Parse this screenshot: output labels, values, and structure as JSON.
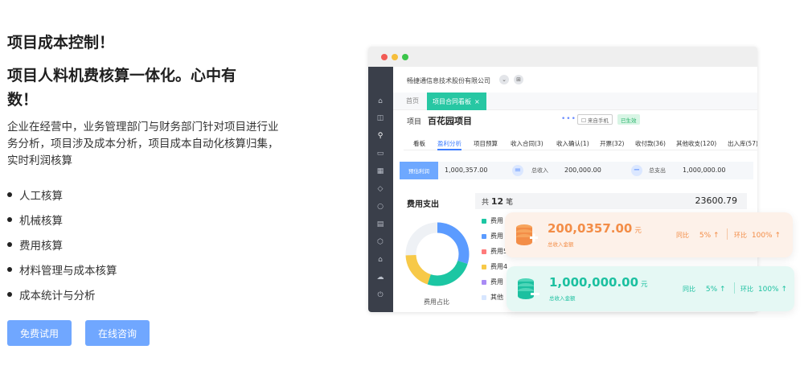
{
  "hero": {
    "title": "项目成本控制！",
    "subtitle": "项目人料机费核算一体化。心中有数！",
    "description": "企业在经营中，业务管理部门与财务部门针对项目进行业务分析，项目涉及成本分析，项目成本自动化核算归集，实时利润核算",
    "features": [
      "人工核算",
      "机械核算",
      "费用核算",
      "材料管理与成本核算",
      "成本统计与分析"
    ],
    "btn_try": "免费试用",
    "btn_consult": "在线咨询"
  },
  "app": {
    "company": "畅捷通信息技术股份有限公司",
    "tab_home": "首页",
    "tab_active": "项目合同看板",
    "tab_close": "×",
    "project_label": "项目",
    "project_name": "百花园项目",
    "project_more": "•••",
    "mobile_label": "☐ 来自手机",
    "status_badge": "已生效",
    "subnav": [
      "看板",
      "盈利分析",
      "项目预算",
      "收入合同(3)",
      "收入确认(1)",
      "开票(32)",
      "收付款(36)",
      "其他收支(120)",
      "出入库(57)"
    ],
    "calc": {
      "tag": "预估利润",
      "profit": "1,000,357.00",
      "op_eq": "=",
      "income_label": "总收入",
      "income": "200,000.00",
      "op_minus": "−",
      "expense_label": "总支出",
      "expense": "1,000,000.00"
    },
    "expense": {
      "title": "费用支出",
      "count_prefix": "共",
      "count": "12",
      "count_suffix": "笔",
      "total": "23600.79",
      "donut_label": "费用占比",
      "legend": [
        {
          "label": "费用",
          "color": "#1cc6a3"
        },
        {
          "label": "费用",
          "color": "#5b9bff"
        },
        {
          "label": "费用5",
          "color": "#ff7b7b"
        },
        {
          "label": "费用4",
          "color": "#f7c948"
        },
        {
          "label": "费用",
          "color": "#a98bf5"
        },
        {
          "label": "其他",
          "color": "#d7e6ff"
        }
      ]
    }
  },
  "cards": {
    "income": {
      "amount": "200,0357.00",
      "unit": "元",
      "label": "总收入金额",
      "yoy_label": "同比",
      "yoy": "5% ↑",
      "mom_label": "环比",
      "mom": "100% ↑"
    },
    "expense": {
      "amount": "1,000,000.00",
      "unit": "元",
      "label": "总收入金额",
      "yoy_label": "同比",
      "yoy": "5% ↑",
      "mom_label": "环比",
      "mom": "100% ↑"
    }
  },
  "colors": {
    "primary_button": "#70a7ff",
    "tab_active": "#27c7a3",
    "orange": "#f38d47",
    "teal": "#1cc0a0"
  },
  "icons": {
    "sidebar": [
      "home-icon",
      "dashboard-icon",
      "org-chart-icon",
      "truck-icon",
      "table-icon",
      "tag-icon",
      "user-icon",
      "document-icon",
      "box-icon",
      "house-icon",
      "cloud-icon",
      "power-icon"
    ]
  }
}
